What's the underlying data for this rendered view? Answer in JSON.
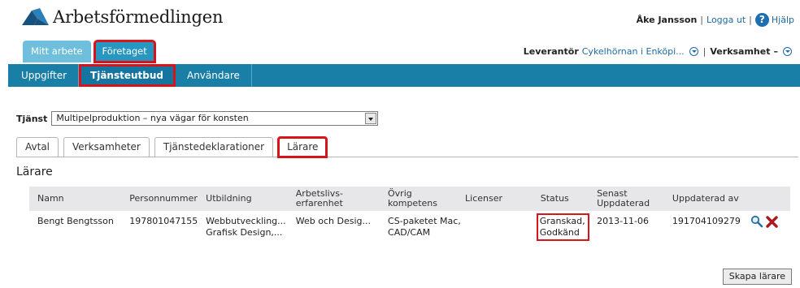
{
  "header": {
    "logo_text": "Arbetsförmedlingen",
    "user_name": "Åke Jansson",
    "logout": "Logga ut",
    "help": "Hjälp",
    "help_glyph": "?",
    "separator": "|"
  },
  "top_tabs": [
    {
      "label": "Mitt arbete"
    },
    {
      "label": "Företaget"
    }
  ],
  "provider": {
    "label": "Leverantör",
    "value": "Cykelhörnan i Enköpi...",
    "activity_label": "Verksamhet",
    "activity_value": "–"
  },
  "nav": [
    {
      "label": "Uppgifter"
    },
    {
      "label": "Tjänsteutbud"
    },
    {
      "label": "Användare"
    }
  ],
  "service": {
    "label": "Tjänst",
    "selected": "Multipelproduktion – nya vägar för konsten"
  },
  "sub_tabs": [
    {
      "label": "Avtal"
    },
    {
      "label": "Verksamheter"
    },
    {
      "label": "Tjänstedeklarationer"
    },
    {
      "label": "Lärare"
    }
  ],
  "section_title": "Lärare",
  "table": {
    "headers": [
      "Namn",
      "Personnummer",
      "Utbildning",
      "Arbetslivs-erfarenhet",
      "Övrig kompetens",
      "Licenser",
      "Status",
      "Senast Uppdaterad",
      "Uppdaterad av"
    ],
    "header_lines": {
      "arbetslivs_1": "Arbetslivs-",
      "arbetslivs_2": "erfarenhet",
      "senast_1": "Senast",
      "senast_2": "Uppdaterad"
    },
    "rows": [
      {
        "name": "Bengt Bengtsson",
        "personnummer": "197801047155",
        "utbildning_1": "Webbutveckling...",
        "utbildning_2": "Grafisk Design,...",
        "erfarenhet": "Web och Desig...",
        "kompetens_1": "CS-paketet Mac,",
        "kompetens_2": "CAD/CAM",
        "licenser": "",
        "status_1": "Granskad,",
        "status_2": "Godkänd",
        "senast": "2013-11-06",
        "uppdaterad_av": "191704109279"
      }
    ]
  },
  "icons": {
    "view": "magnifier-icon",
    "delete": "delete-icon"
  },
  "colors": {
    "nav_blue": "#1a7fa7",
    "tab_blue": "#3aa0c8",
    "highlight_red": "#d7141b",
    "link_blue": "#1f6aa5"
  },
  "create_button": "Skapa lärare"
}
